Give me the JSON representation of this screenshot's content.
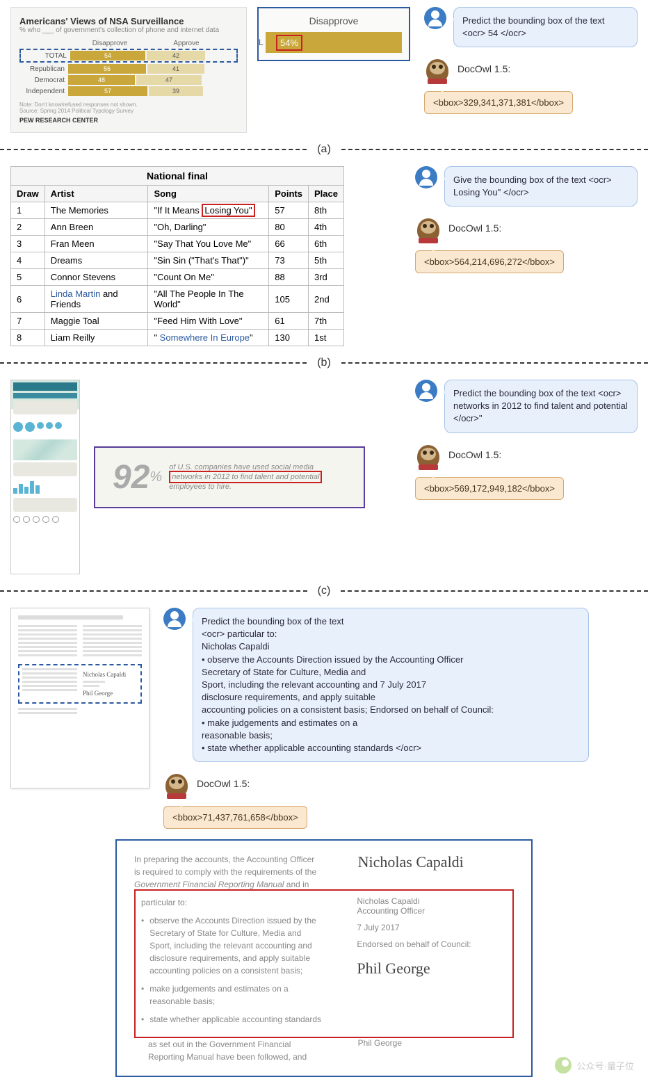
{
  "owl_label": "DocOwl 1.5:",
  "panel_labels": {
    "a": "(a)",
    "b": "(b)",
    "c": "(c)"
  },
  "panel_a": {
    "chart": {
      "title": "Americans' Views of NSA Surveillance",
      "subtitle": "% who ___ of government's collection of phone and internet data",
      "header_disapprove": "Disapprove",
      "header_approve": "Approve",
      "note": "Note: Don't know/refused responses not shown.",
      "source": "Source: Spring 2014 Political Typology Survey",
      "footer": "PEW RESEARCH CENTER"
    },
    "zoom": {
      "header": "Disapprove",
      "value": "54%",
      "left_l": "L"
    },
    "user_prompt": "Predict the bounding box of the text <ocr> 54 </ocr>",
    "owl_output": "<bbox>329,341,371,381</bbox>"
  },
  "chart_data": {
    "type": "bar",
    "title": "Americans' Views of NSA Surveillance",
    "categories": [
      "TOTAL",
      "Republican",
      "Democrat",
      "Independent"
    ],
    "series": [
      {
        "name": "Disapprove",
        "values": [
          54,
          56,
          48,
          57
        ]
      },
      {
        "name": "Approve",
        "values": [
          42,
          41,
          47,
          39
        ]
      }
    ],
    "xlabel": "",
    "ylabel": "%",
    "ylim": [
      0,
      100
    ]
  },
  "panel_b": {
    "caption": "National final",
    "headers": [
      "Draw",
      "Artist",
      "Song",
      "Points",
      "Place"
    ],
    "rows": [
      {
        "draw": "1",
        "artist": "The Memories",
        "song_pre": "\"If It Means ",
        "song_hl": "Losing You\"",
        "points": "57",
        "place": "8th"
      },
      {
        "draw": "2",
        "artist": "Ann Breen",
        "song": "\"Oh, Darling\"",
        "points": "80",
        "place": "4th"
      },
      {
        "draw": "3",
        "artist": "Fran Meen",
        "song": "\"Say That You Love Me\"",
        "points": "66",
        "place": "6th"
      },
      {
        "draw": "4",
        "artist": "Dreams",
        "song": "\"Sin Sin (\"That's That\")\"",
        "points": "73",
        "place": "5th"
      },
      {
        "draw": "5",
        "artist": "Connor Stevens",
        "song": "\"Count On Me\"",
        "points": "88",
        "place": "3rd"
      },
      {
        "draw": "6",
        "artist_link": "Linda Martin",
        "artist_rest": " and Friends",
        "song": "\"All The People In The World\"",
        "points": "105",
        "place": "2nd"
      },
      {
        "draw": "7",
        "artist": "Maggie Toal",
        "song": "\"Feed Him With Love\"",
        "points": "61",
        "place": "7th"
      },
      {
        "draw": "8",
        "artist": "Liam Reilly",
        "song_pre": "\" ",
        "song_link": "Somewhere In Europe",
        "song_post": "\"",
        "points": "130",
        "place": "1st"
      }
    ],
    "user_prompt": "Give the bounding box of the text <ocr> Losing You\" </ocr>",
    "owl_output": "<bbox>564,214,696,272</bbox>"
  },
  "panel_c": {
    "zoom": {
      "big": "92",
      "pct": "%",
      "line1": "of U.S. companies have used social media",
      "line2_hl": "networks in 2012 to find talent and potential",
      "line3": "employees to hire."
    },
    "user_prompt": "Predict the bounding box of the text <ocr> networks in 2012 to find talent and potential </ocr>\"",
    "owl_output": "<bbox>569,172,949,182</bbox>"
  },
  "panel_d": {
    "user_prompt": "Predict the bounding box of the text\n<ocr> particular to:\nNicholas Capaldi\n• observe the Accounts Direction issued by the Accounting Officer\nSecretary of State for Culture, Media and\nSport, including the relevant accounting and 7 July 2017\ndisclosure requirements, and apply suitable\naccounting policies on a consistent basis; Endorsed on behalf of Council:\n• make judgements and estimates on a\nreasonable basis;\n• state whether applicable accounting standards </ocr>",
    "owl_output": "<bbox>71,437,761,658</bbox>",
    "zoom": {
      "intro1": "In preparing the accounts, the Accounting Officer",
      "intro2": "is required to comply with the requirements of the",
      "intro3_it": "Government Financial Reporting Manual",
      "intro3_rest": " and in",
      "particular": "particular to:",
      "b1_l1": "observe the Accounts Direction issued by the",
      "b1_l2": "Secretary of State for Culture, Media and",
      "b1_l3": "Sport, including the relevant accounting and",
      "b1_l4": "disclosure requirements, and apply suitable",
      "b1_l5": "accounting policies on a consistent basis;",
      "b2_l1": "make judgements and estimates on a",
      "b2_l2": "reasonable basis;",
      "b3_l1": "state whether applicable accounting standards",
      "tail1": "as set out in the Government Financial",
      "tail2": "Reporting Manual have been followed, and",
      "sig1": "Nicholas Capaldi",
      "name1": "Nicholas Capaldi",
      "role1": "Accounting Officer",
      "date1": "7 July 2017",
      "endorsed": "Endorsed on behalf of Council:",
      "sig2": "Phil George",
      "name2": "Phil George"
    }
  },
  "watermark": "公众号·量子位"
}
